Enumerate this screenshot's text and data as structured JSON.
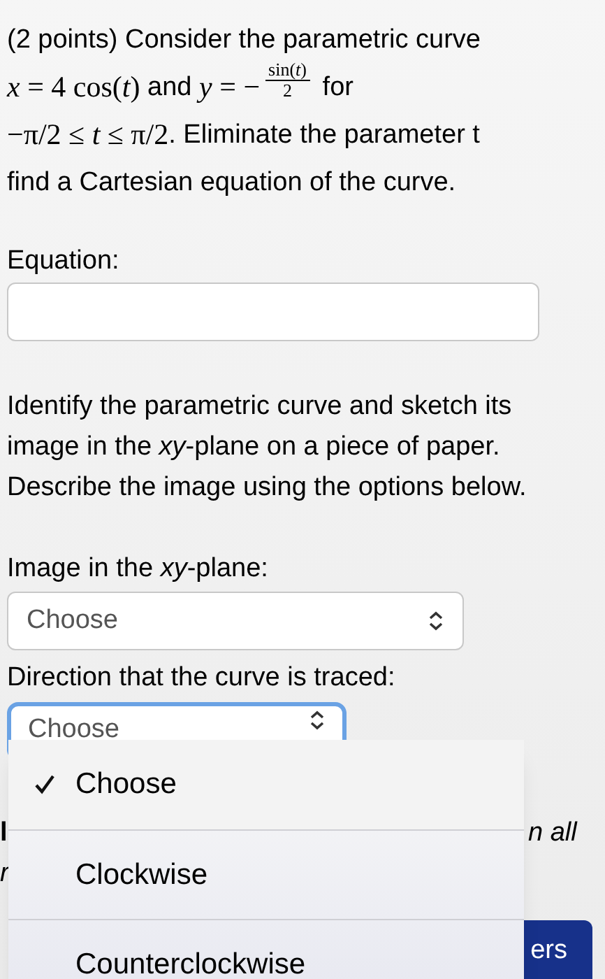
{
  "prompt": [
    [
      {
        "kind": "text",
        "text": "(2 points) Consider the parametric curve"
      }
    ],
    [
      {
        "kind": "math",
        "text": "*x* = 4 cos(*t*)"
      },
      {
        "kind": "text",
        "text": " and "
      },
      {
        "kind": "math",
        "text": "*y* = −"
      },
      {
        "kind": "fraction",
        "numerator": "sin(*t*)",
        "denominator": "2"
      },
      {
        "kind": "text",
        "text": " for"
      }
    ],
    [
      {
        "kind": "math",
        "text": "−π/2 ≤ *t* ≤ π/2"
      },
      {
        "kind": "text",
        "text": ". Eliminate the parameter t"
      }
    ],
    [
      {
        "kind": "text",
        "text": "find a Cartesian equation of the curve."
      }
    ]
  ],
  "equation": {
    "label": "Equation:"
  },
  "instructions": "Identify the parametric curve and sketch its image in the *xy*-plane on a piece of paper. Describe the image using the options below.",
  "selects": [
    {
      "label": "Image in the *xy*-plane:",
      "value": "Choose",
      "focused": false
    },
    {
      "label": "Direction that the curve is traced:",
      "value": "Choose",
      "focused": true
    }
  ],
  "hidden_note": {
    "left_1": "l",
    "left_2": "r",
    "right": "n all"
  },
  "submit_button": "ers",
  "menu": [
    {
      "label": "Choose",
      "selected": true
    },
    {
      "label": "Clockwise",
      "selected": false
    },
    {
      "label": "Counterclockwise",
      "selected": false
    }
  ]
}
